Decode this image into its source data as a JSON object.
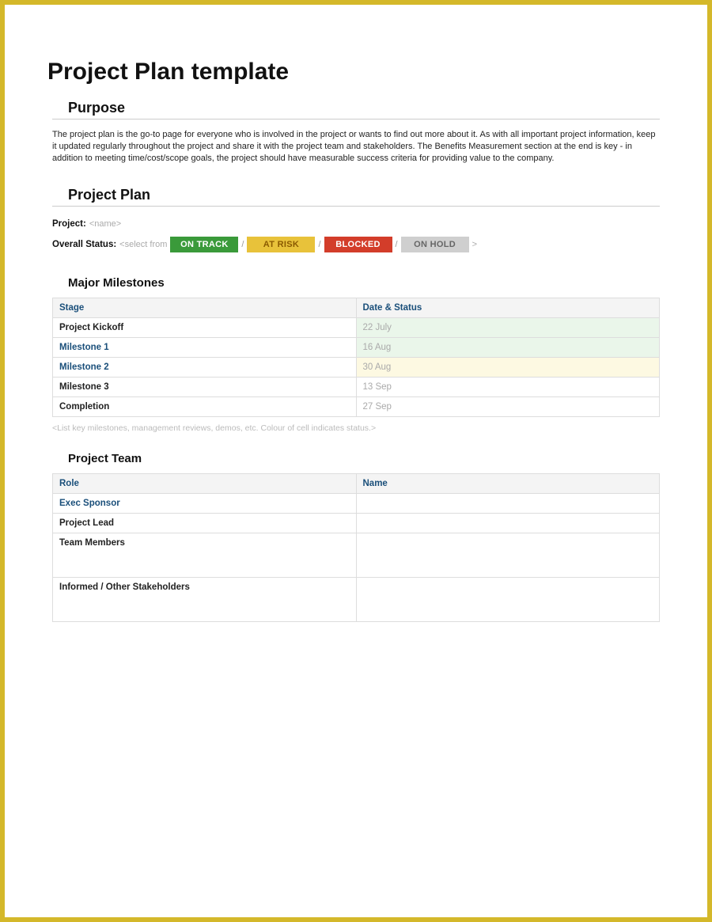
{
  "title": "Project Plan template",
  "purpose": {
    "heading": "Purpose",
    "text": "The project plan is the go-to page for everyone who is involved in the project or wants to find out more about it.   As with all important project information, keep it updated regularly throughout the project and share it with the project team and stakeholders.   The Benefits Measurement section at the end is key - in addition to meeting time/cost/scope goals, the project should have measurable success criteria for providing value to the company."
  },
  "plan": {
    "heading": "Project Plan",
    "project_label": "Project:",
    "project_value": "<name>",
    "status_label": "Overall Status:",
    "status_hint": "<select from",
    "sep": "/",
    "close": ">",
    "badges": {
      "on_track": "ON TRACK",
      "at_risk": "AT RISK",
      "blocked": "BLOCKED",
      "on_hold": "ON HOLD"
    }
  },
  "milestones": {
    "heading": "Major Milestones",
    "col_stage": "Stage",
    "col_date": "Date & Status",
    "rows": [
      {
        "stage": "Project Kickoff",
        "date": "22 July",
        "link": false,
        "tint": "green"
      },
      {
        "stage": "Milestone 1",
        "date": "16 Aug",
        "link": true,
        "tint": "green"
      },
      {
        "stage": "Milestone 2",
        "date": "30 Aug",
        "link": true,
        "tint": "yellow"
      },
      {
        "stage": "Milestone 3",
        "date": "13 Sep",
        "link": false,
        "tint": ""
      },
      {
        "stage": "Completion",
        "date": "27 Sep",
        "link": false,
        "tint": ""
      }
    ],
    "note": "<List key milestones, management reviews, demos, etc.  Colour of cell indicates status.>"
  },
  "team": {
    "heading": "Project Team",
    "col_role": "Role",
    "col_name": "Name",
    "rows": [
      {
        "role": "Exec Sponsor",
        "link": true,
        "tall": false
      },
      {
        "role": "Project Lead",
        "link": false,
        "tall": false
      },
      {
        "role": "Team Members",
        "link": false,
        "tall": true
      },
      {
        "role": "Informed / Other Stakeholders",
        "link": false,
        "tall": true
      }
    ]
  }
}
